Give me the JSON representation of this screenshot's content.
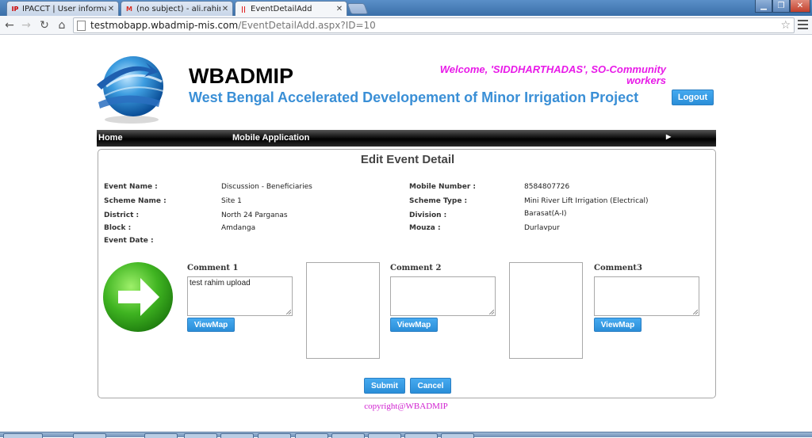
{
  "browser": {
    "tabs": [
      {
        "title": "IPACCT | User information",
        "icon": "IP"
      },
      {
        "title": "(no subject) - ali.rahim08",
        "icon": "M"
      },
      {
        "title": "EventDetailAdd",
        "icon": "||"
      }
    ],
    "url_host": "testmobapp.wbadmip-mis.com",
    "url_path": "/EventDetailAdd.aspx?ID=10"
  },
  "header": {
    "brand": "WBADMIP",
    "subtitle": "West Bengal Accelerated Developement of Minor Irrigation Project",
    "welcome": "Welcome, 'SIDDHARTHADAS', SO-Community workers",
    "logout_label": "Logout"
  },
  "nav": {
    "home": "Home",
    "mobile_application": "Mobile Application"
  },
  "panel": {
    "title": "Edit Event Detail"
  },
  "details": {
    "event_name_label": "Event Name :",
    "event_name": "Discussion - Beneficiaries",
    "scheme_name_label": "Scheme Name :",
    "scheme_name": "Site 1",
    "district_label": "District :",
    "district": "North 24 Parganas",
    "block_label": "Block :",
    "block": "Amdanga",
    "event_date_label": "Event Date :",
    "mobile_number_label": "Mobile Number :",
    "mobile_number": "8584807726",
    "scheme_type_label": "Scheme Type :",
    "scheme_type": "Mini River Lift Irrigation (Electrical)",
    "division_label": "Division :",
    "division": "Barasat(A-I)",
    "mouza_label": "Mouza :",
    "mouza": "Durlavpur"
  },
  "comments": {
    "comment1_label": "Comment 1",
    "comment1_value": "test rahim upload",
    "comment2_label": "Comment 2",
    "comment2_value": "",
    "comment3_label": "Comment3",
    "comment3_value": "",
    "viewmap_label": "ViewMap"
  },
  "actions": {
    "submit_label": "Submit",
    "cancel_label": "Cancel"
  },
  "footer": {
    "copyright": "copyright@WBADMIP"
  },
  "colors": {
    "accent_blue": "#3a8fd6",
    "welcome_magenta": "#e81ae8",
    "copyright_magenta": "#d020d0",
    "button_blue": "#2a8ed8"
  }
}
